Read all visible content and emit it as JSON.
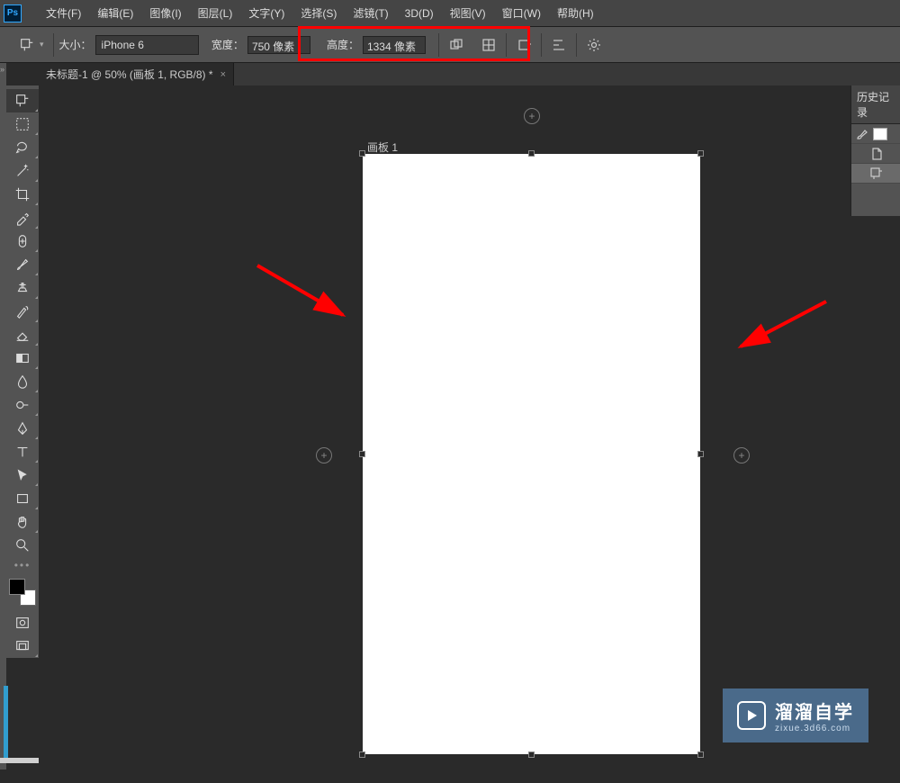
{
  "app": {
    "logo_text": "Ps"
  },
  "menu": {
    "file": "文件(F)",
    "edit": "编辑(E)",
    "image": "图像(I)",
    "layer": "图层(L)",
    "type": "文字(Y)",
    "select": "选择(S)",
    "filter": "滤镜(T)",
    "3d": "3D(D)",
    "view": "视图(V)",
    "window": "窗口(W)",
    "help": "帮助(H)"
  },
  "options": {
    "size_label": "大小：",
    "size_preset": "iPhone 6",
    "width_label": "宽度：",
    "width_value": "750 像素",
    "height_label": "高度：",
    "height_value": "1334 像素"
  },
  "tab": {
    "title": "未标题-1 @ 50% (画板 1, RGB/8) *"
  },
  "artboard": {
    "label": "画板 1"
  },
  "panels": {
    "history_title": "历史记录"
  },
  "watermark": {
    "main": "溜溜自学",
    "sub": "zixue.3d66.com"
  },
  "icons": {
    "plus": "+"
  }
}
